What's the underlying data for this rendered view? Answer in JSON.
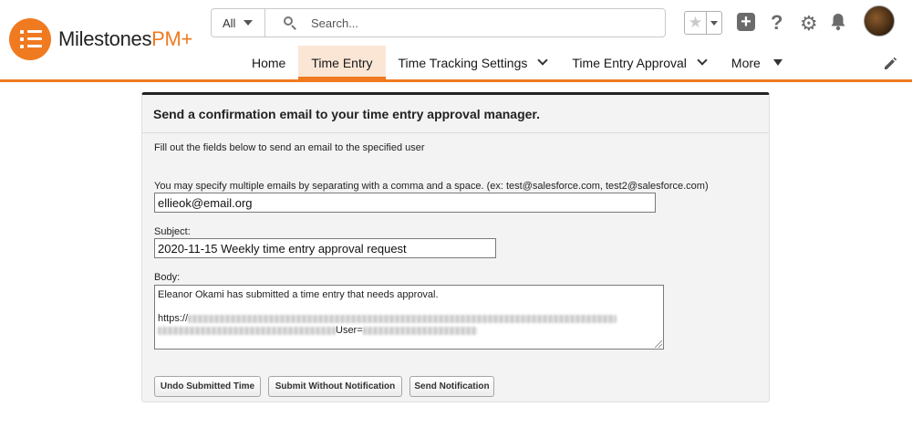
{
  "app": {
    "name_main": "Milestones",
    "name_accent": "PM+"
  },
  "search": {
    "scope": "All",
    "placeholder": "Search..."
  },
  "nav": {
    "tabs": [
      {
        "label": "Home"
      },
      {
        "label": "Time Entry"
      },
      {
        "label": "Time Tracking Settings"
      },
      {
        "label": "Time Entry Approval"
      },
      {
        "label": "More"
      }
    ]
  },
  "form": {
    "title": "Send a confirmation email to your time entry approval manager.",
    "intro": "Fill out the fields below to send an email to the specified user",
    "to_label": "You may specify multiple emails by separating with a comma and a space. (ex: test@salesforce.com, test2@salesforce.com)",
    "to_value": "ellieok@email.org",
    "subject_label": "Subject:",
    "subject_value": "2020-11-15 Weekly time entry approval request",
    "body_label": "Body:",
    "body_line1": "Eleanor Okami has submitted a time entry that needs approval.",
    "body_link_prefix": "https://",
    "body_user_param": "User="
  },
  "buttons": {
    "undo": "Undo Submitted Time",
    "submit_silent": "Submit Without Notification",
    "send": "Send Notification"
  }
}
